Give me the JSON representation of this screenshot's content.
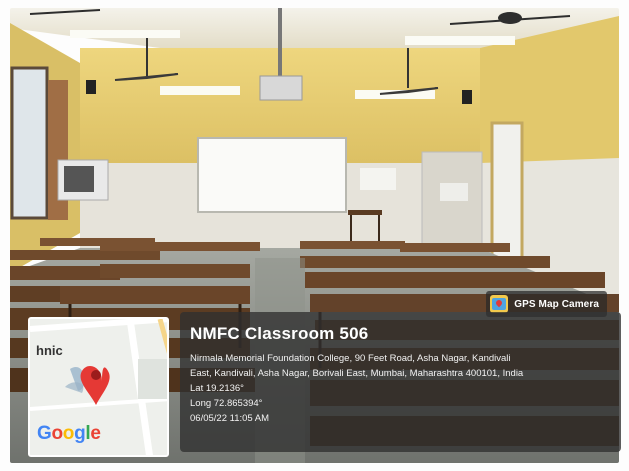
{
  "badge": {
    "label": "GPS Map Camera",
    "icon": "gps-map-camera-icon"
  },
  "location": {
    "title": "NMFC Classroom 506",
    "address_line1": "Nirmala Memorial Foundation College, 90 Feet Road, Asha Nagar, Kandivali",
    "address_line2": "East, Kandivali, Asha Nagar, Borivali East, Mumbai, Maharashtra 400101, India",
    "latitude": "Lat 19.2136°",
    "longitude": "Long 72.865394°",
    "datetime": "06/05/22 11:05 AM"
  },
  "map": {
    "place_label": "hnic",
    "provider_logo": [
      "G",
      "o",
      "o",
      "g",
      "l",
      "e"
    ],
    "pin_color": "#e53935"
  },
  "colors": {
    "wall_yellow": "#e8cf73",
    "tile_white": "#e9e7df",
    "bench_brown": "#6f4a2c",
    "floor": "#8b8f88"
  }
}
